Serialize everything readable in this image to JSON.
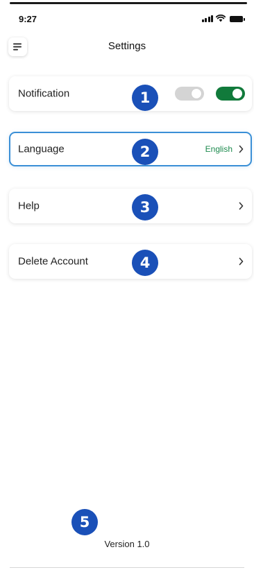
{
  "status_bar": {
    "time": "9:27",
    "icons": [
      "signal-icon",
      "wifi-icon",
      "battery-icon"
    ]
  },
  "header": {
    "title": "Settings",
    "menu_icon": "menu-icon"
  },
  "settings": {
    "notification": {
      "label": "Notification",
      "toggle_off_state": false,
      "toggle_on_state": true
    },
    "language": {
      "label": "Language",
      "value": "English"
    },
    "help": {
      "label": "Help"
    },
    "delete_account": {
      "label": "Delete Account"
    }
  },
  "markers": [
    "1",
    "2",
    "3",
    "4",
    "5"
  ],
  "footer": {
    "version": "Version 1.0"
  },
  "colors": {
    "toggle_on": "#117a3b",
    "toggle_off": "#d4d4d4",
    "language_value": "#1d8a4e",
    "selected_border": "#3a8fd6",
    "marker": "#1a50b8"
  }
}
